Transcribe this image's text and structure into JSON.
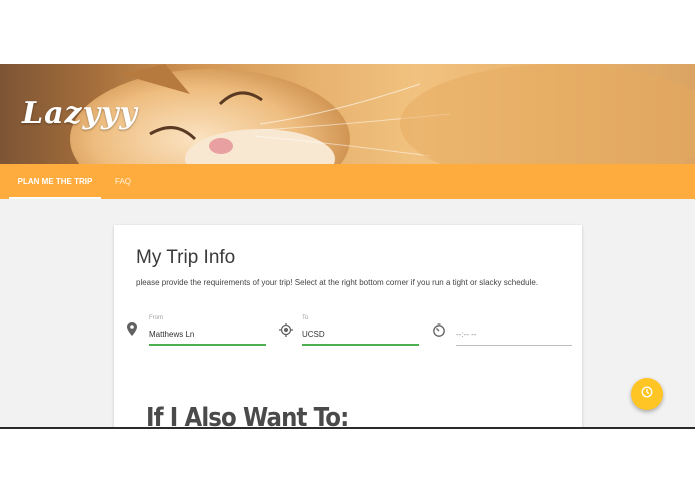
{
  "brand": {
    "name": "Lazyyy"
  },
  "nav": {
    "tabs": [
      {
        "label": "PLAN ME THE TRIP",
        "active": true
      },
      {
        "label": "FAQ",
        "active": false
      }
    ]
  },
  "trip_card": {
    "title": "My Trip Info",
    "description": "please provide the requirements of your trip! Select at the right bottom corner if you run a tight or slacky schedule.",
    "from": {
      "label": "From",
      "value": "Matthews Ln",
      "icon": "location-pin-icon"
    },
    "to": {
      "label": "To",
      "value": "UCSD",
      "icon": "target-location-icon"
    },
    "time": {
      "placeholder": "--:-- --",
      "icon": "timer-icon"
    }
  },
  "extras": {
    "title": "If I Also Want To:"
  },
  "fab": {
    "icon": "clock-icon"
  },
  "colors": {
    "nav_bar": "#ffac3f",
    "fab": "#ffc524",
    "active_underline": "#4caf50"
  }
}
